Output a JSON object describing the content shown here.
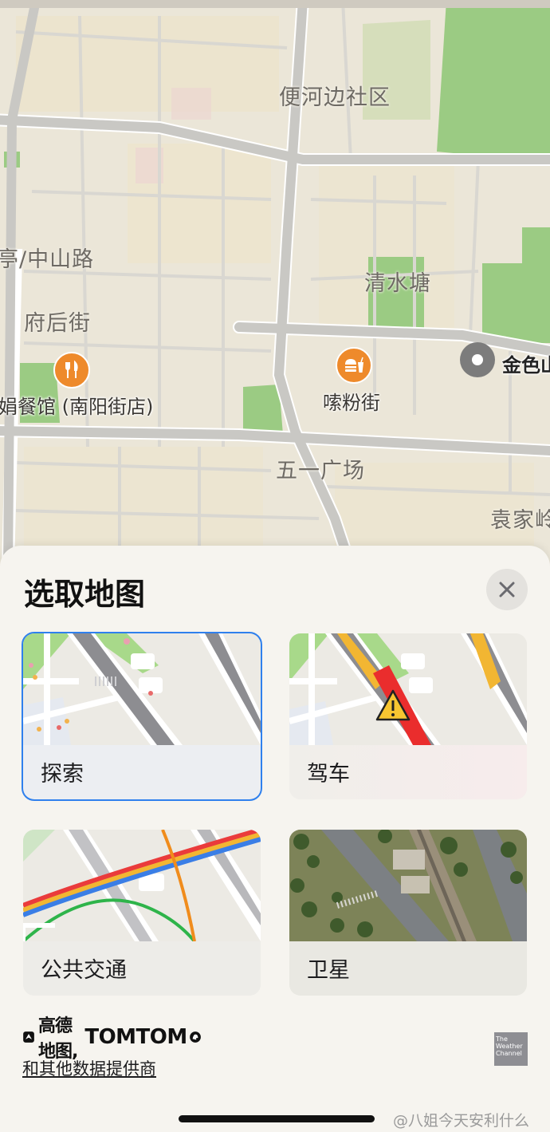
{
  "map": {
    "labels": {
      "district": "便河边社区",
      "road_zhongshan": "亭/中山路",
      "fuhoujie": "府后街",
      "qingshuitang": "清水塘",
      "wuyi_square": "五一广场",
      "yuanjia": "袁家岭",
      "jinse": "金色山"
    },
    "pois": {
      "restaurant_label": "娟餐馆 (南阳街店)",
      "food_street_label": "嗦粉街"
    },
    "colors": {
      "land": "#eae6d9",
      "road": "#c9c8c4",
      "park": "#9bcb83",
      "poi": "#ee8a2b"
    }
  },
  "sheet": {
    "title": "选取地图",
    "close_icon": "close-icon",
    "cards": [
      {
        "id": "explore",
        "label": "探索",
        "selected": true
      },
      {
        "id": "driving",
        "label": "驾车",
        "selected": false
      },
      {
        "id": "transit",
        "label": "公共交通",
        "selected": false
      },
      {
        "id": "satellite",
        "label": "卫星",
        "selected": false
      }
    ],
    "attribution": {
      "amap": "高德地图,",
      "tomtom": "TOMTOM",
      "providers_link": "和其他数据提供商",
      "weather": "The Weather Channel"
    }
  },
  "watermark": "@八姐今天安利什么",
  "accent_color": "#2f80ed"
}
